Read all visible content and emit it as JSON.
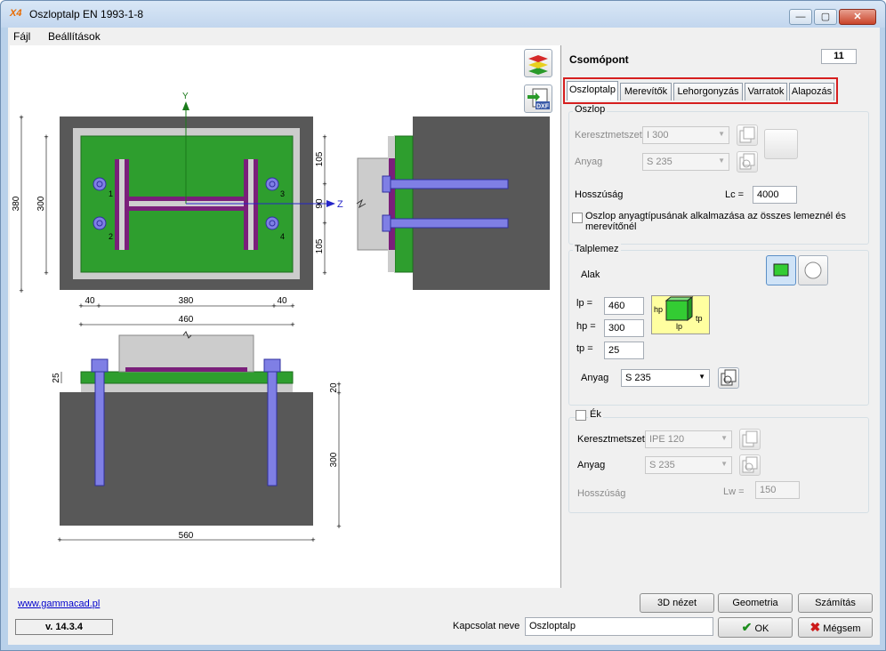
{
  "window": {
    "logo": "X4",
    "title": "Oszloptalp EN 1993-1-8",
    "minimize": "—",
    "maximize": "▢",
    "close": "✕"
  },
  "menu": {
    "items": [
      "Fájl",
      "Beállítások"
    ]
  },
  "toolbar": {
    "icons": [
      "layers-icon",
      "dxf-export-icon"
    ],
    "dxf_label": "DXF"
  },
  "drawing": {
    "plan": {
      "axis_y": "Y",
      "axis_z": "Z",
      "bolt_numbers": [
        "1",
        "2",
        "3",
        "4"
      ],
      "dim_left_outer": "380",
      "dim_left_inner": "300",
      "dim_right_top": "105",
      "dim_right_mid": "90",
      "dim_right_bottom": "105",
      "dim_bottom_left": "40",
      "dim_bottom_mid": "380",
      "dim_bottom_right": "40",
      "dim_bottom_total": "460"
    },
    "elevation": {
      "dim_plate": "25",
      "dim_grout": "20",
      "dim_foundation_height": "300",
      "dim_foundation_width": "560"
    },
    "colors": {
      "concrete": "#585858",
      "plate": "#2e9e2e",
      "steel": "#7a1f7a",
      "bolt": "#7f7fe5",
      "grout": "#cccccc"
    }
  },
  "panel": {
    "node_label": "Csomópont",
    "node_number": "11",
    "tabs": [
      "Oszloptalp",
      "Merevítők",
      "Lehorgonyzás",
      "Varratok",
      "Alapozás"
    ],
    "active_tab": "Oszloptalp",
    "column": {
      "title": "Oszlop",
      "section_label": "Keresztmetszet",
      "section_value": "I 300",
      "material_label": "Anyag",
      "material_value": "S 235",
      "length_label": "Hosszúság",
      "length_symbol": "Lc =",
      "length_value": "4000",
      "apply_checkbox_label": "Oszlop anyagtípusának alkalmazása az összes lemeznél és merevítőnél"
    },
    "baseplate": {
      "title": "Talplemez",
      "shape_label": "Alak",
      "lp_label": "lp =",
      "lp_value": "460",
      "hp_label": "hp =",
      "hp_value": "300",
      "tp_label": "tp =",
      "tp_value": "25",
      "material_label": "Anyag",
      "material_value": "S 235",
      "diagram_labels": {
        "hp": "hp",
        "lp": "lp",
        "tp": "tp"
      }
    },
    "wedge": {
      "checkbox_label": "Ék",
      "section_label": "Keresztmetszet",
      "section_value": "IPE 120",
      "material_label": "Anyag",
      "material_value": "S 235",
      "length_label": "Hosszúság",
      "length_symbol": "Lw =",
      "length_value": "150"
    }
  },
  "footer": {
    "website": "www.gammacad.pl",
    "version": "v. 14.3.4",
    "btn_3d": "3D nézet",
    "btn_geometry": "Geometria",
    "btn_calculation": "Számítás",
    "connection_name_label": "Kapcsolat neve",
    "connection_name_value": "Oszloptalp",
    "ok_icon": "checkmark-icon",
    "ok_label": "OK",
    "cancel_icon": "cross-icon",
    "cancel_label": "Mégsem"
  }
}
